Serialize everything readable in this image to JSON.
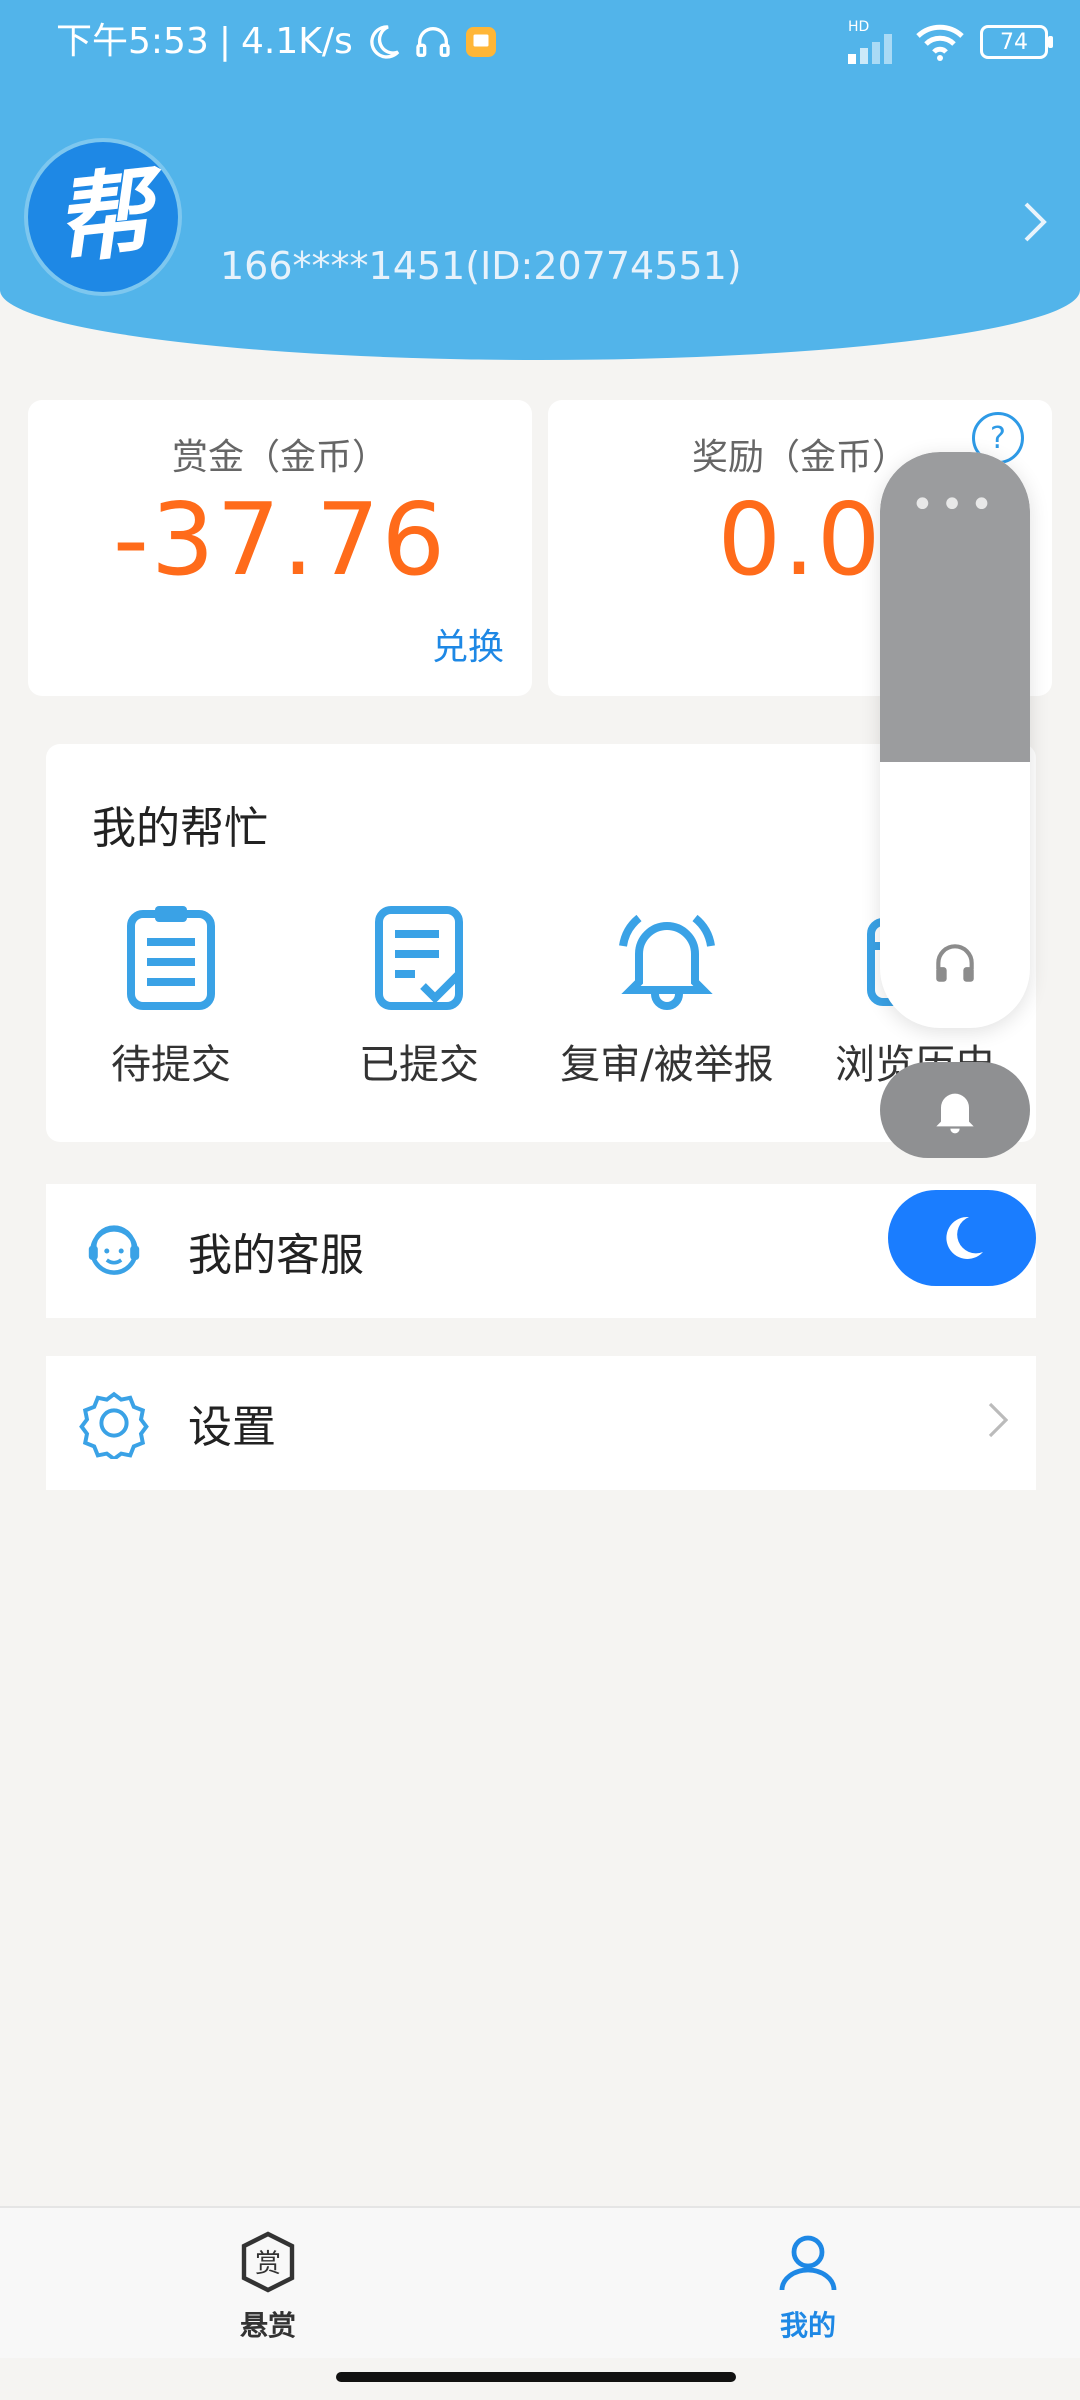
{
  "status_bar": {
    "time": "下午5:53",
    "net_speed": "4.1K/s",
    "battery": "74",
    "net_label": "HD"
  },
  "profile": {
    "logo_text": "帮",
    "user_id": "166****1451(ID:20774551)"
  },
  "bounty_card": {
    "label": "赏金（金币）",
    "amount": "-37.76",
    "exchange_label": "兑换"
  },
  "reward_card": {
    "label": "奖励（金币）",
    "amount": "0.0",
    "help_symbol": "?"
  },
  "my_help": {
    "title": "我的帮忙",
    "items": [
      {
        "label": "待提交",
        "icon": "clipboard-icon"
      },
      {
        "label": "已提交",
        "icon": "checked-doc-icon"
      },
      {
        "label": "复审/被举报",
        "icon": "bell-icon"
      },
      {
        "label": "浏览历史",
        "icon": "calendar-icon"
      }
    ]
  },
  "menu": {
    "customer_service": "我的客服",
    "settings": "设置"
  },
  "overlay": {
    "dots": "•••"
  },
  "nav": {
    "bounty": "悬赏",
    "bounty_icon_char": "赏",
    "mine": "我的"
  },
  "colors": {
    "header": "#52b4ea",
    "accent": "#1e88e5",
    "amount": "#ff6b1a"
  }
}
